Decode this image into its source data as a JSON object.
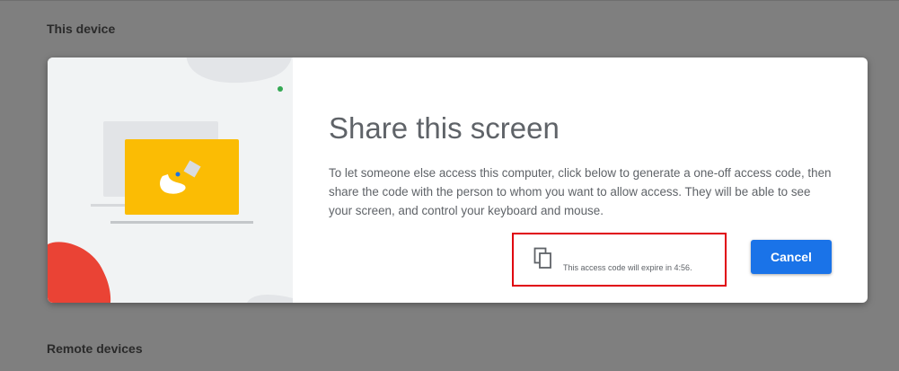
{
  "sections": {
    "this_device_label": "This device",
    "remote_devices_label": "Remote devices"
  },
  "dialog": {
    "title": "Share this screen",
    "description": "To let someone else access this computer, click below to generate a one-off access code, then share the code with the person to whom you want to allow access. They will be able to see your screen, and control your keyboard and mouse.",
    "expire_text": "This access code will expire in 4:56.",
    "cancel_label": "Cancel",
    "copy_icon": "copy-icon"
  },
  "colors": {
    "accent": "#1a73e8",
    "highlight_border": "#e0000f",
    "illustration_yellow": "#fbbc04",
    "illustration_red": "#ea4335",
    "illustration_green": "#34a853",
    "backdrop": "#7f7f7f"
  }
}
